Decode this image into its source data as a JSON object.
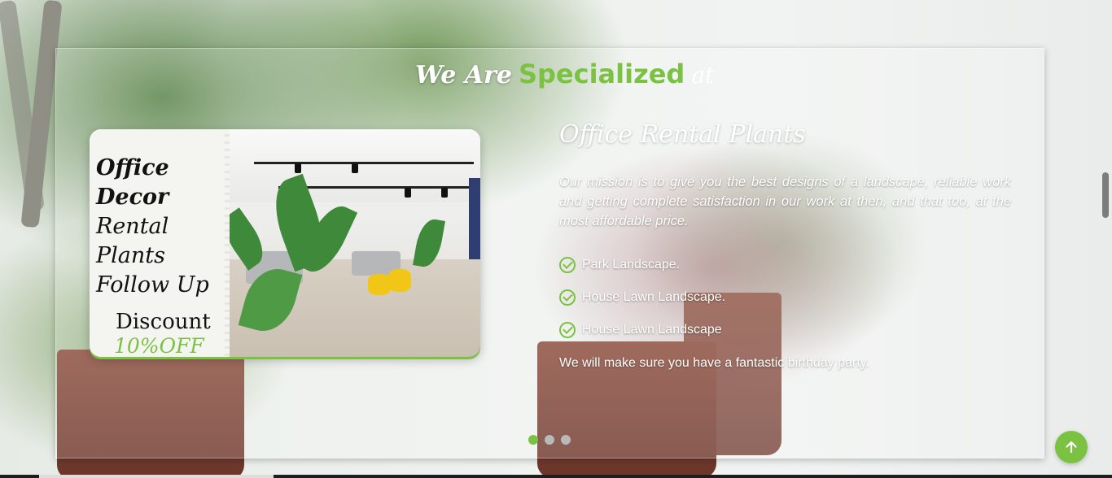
{
  "section": {
    "heading_script": "We Are",
    "heading_accent": "Specialized",
    "heading_tail": "at"
  },
  "promo": {
    "lines": [
      "Office Decor",
      "Rental",
      "Plants",
      "Follow Up"
    ],
    "discount_label": "Discount",
    "discount_value": "10%OFF"
  },
  "slide": {
    "title": "Office Rental Plants",
    "mission": "Our mission is to give you the best designs of a landscape, reliable work and getting complete satisfaction in our work at then, and that too, at the most affordable price.",
    "features": [
      "Park Landscape.",
      "House Lawn Landscape.",
      "House Lawn Landscape"
    ],
    "footer": "We will make sure you have a fantastic birthday party."
  },
  "carousel": {
    "total": 3,
    "active_index": 1
  },
  "colors": {
    "accent": "#7cc242",
    "dot_inactive": "#b9b9b9",
    "text_light": "#ffffff"
  },
  "icons": {
    "check": "check-circle-icon",
    "to_top": "arrow-up-icon"
  }
}
